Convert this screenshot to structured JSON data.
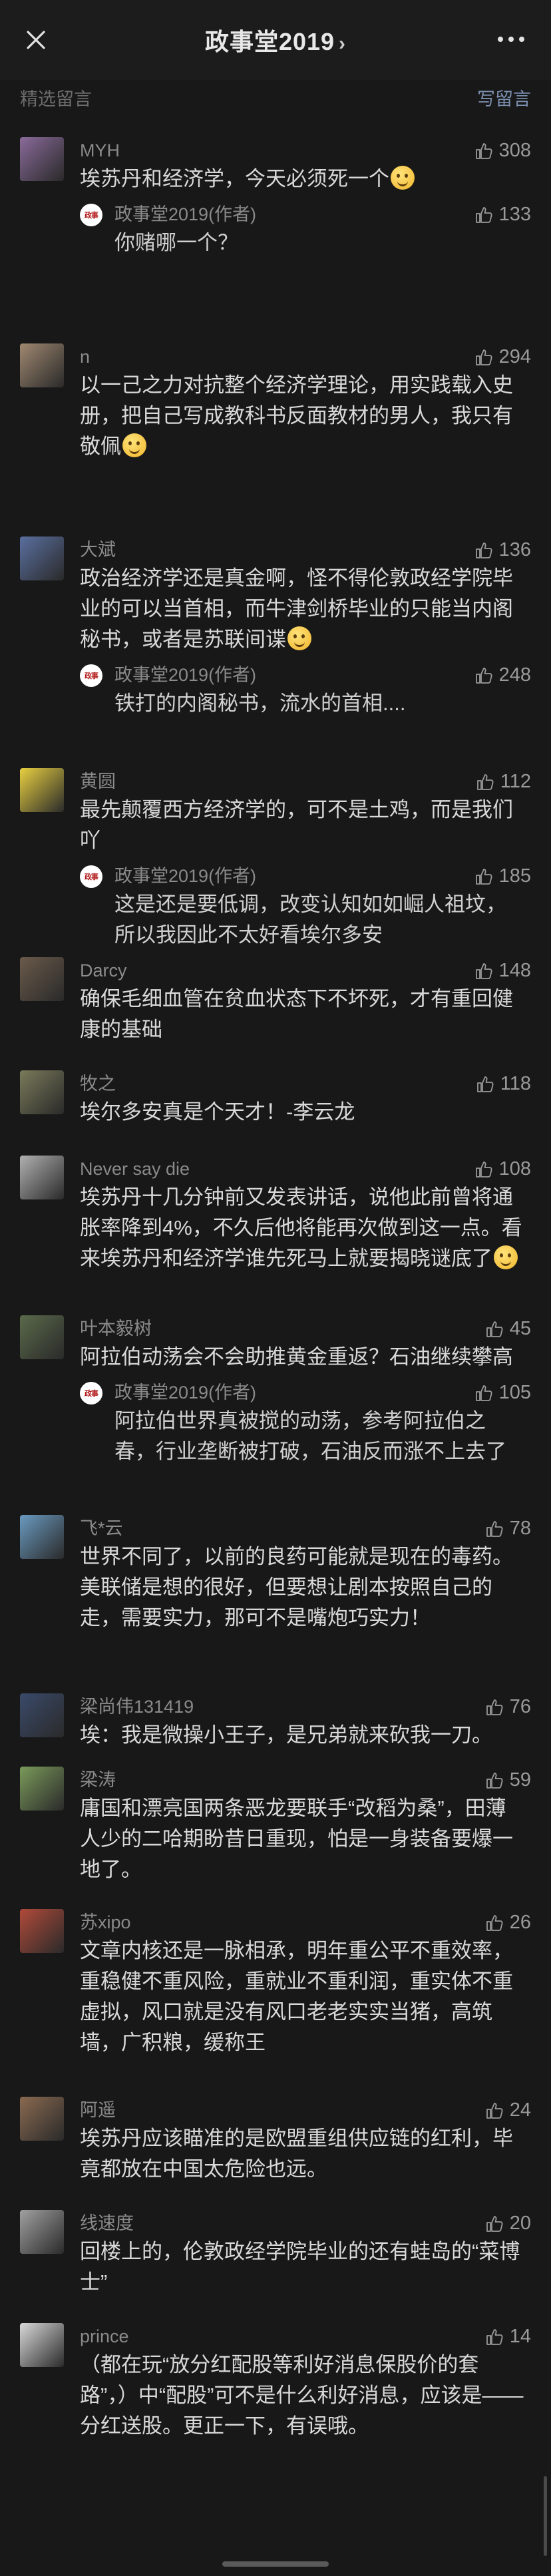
{
  "header": {
    "title": "政事堂2019",
    "chevron": "›",
    "close_icon": "close-icon",
    "more_icon": "more-icon"
  },
  "subbar": {
    "label": "精选留言",
    "write": "写留言"
  },
  "comments": [
    {
      "name": "MYH",
      "likes": "308",
      "text": "埃苏丹和经济学，今天必须死一个",
      "emoji": true,
      "avatar_color": "#8a6a9a",
      "reply": {
        "name": "政事堂2019(作者)",
        "likes": "133",
        "text": "你赌哪一个？"
      }
    },
    {
      "name": "n",
      "likes": "294",
      "text": "以一己之力对抗整个经济学理论，用实践载入史册，把自己写成教科书反面教材的男人，我只有敬佩",
      "emoji": true,
      "avatar_color": "#a08870"
    },
    {
      "name": "大斌",
      "likes": "136",
      "text": "政治经济学还是真金啊，怪不得伦敦政经学院毕业的可以当首相，而牛津剑桥毕业的只能当内阁秘书，或者是苏联间谍",
      "emoji": true,
      "avatar_color": "#5a6fa0",
      "reply": {
        "name": "政事堂2019(作者)",
        "likes": "248",
        "text": "铁打的内阁秘书，流水的首相...."
      }
    },
    {
      "name": "黄圆",
      "likes": "112",
      "text": "最先颠覆西方经济学的，可不是土鸡，而是我们吖",
      "emoji": false,
      "avatar_color": "#e8d040",
      "reply": {
        "name": "政事堂2019(作者)",
        "likes": "185",
        "text": "这是还是要低调，改变认知如如崛人祖坟，所以我因此不太好看埃尔多安"
      }
    },
    {
      "name": "Darcy",
      "likes": "148",
      "text": "确保毛细血管在贫血状态下不坏死，才有重回健康的基础",
      "emoji": false,
      "avatar_color": "#6a5a4a"
    },
    {
      "name": "牧之",
      "likes": "118",
      "text": "埃尔多安真是个天才！-李云龙",
      "emoji": false,
      "avatar_color": "#7a7a5a"
    },
    {
      "name": "Never say die",
      "likes": "108",
      "text": "埃苏丹十几分钟前又发表讲话，说他此前曾将通胀率降到4%，不久后他将能再次做到这一点。看来埃苏丹和经济学谁先死马上就要揭晓谜底了",
      "emoji": true,
      "avatar_color": "#b0b0b0"
    },
    {
      "name": "叶本毅树",
      "likes": "45",
      "text": "阿拉伯动荡会不会助推黄金重返？石油继续攀高",
      "emoji": false,
      "avatar_color": "#5a6a4a",
      "reply": {
        "name": "政事堂2019(作者)",
        "likes": "105",
        "text": "阿拉伯世界真被搅的动荡，参考阿拉伯之春，行业垄断被打破，石油反而涨不上去了"
      }
    },
    {
      "name": "飞*云",
      "likes": "78",
      "text": "世界不同了，以前的良药可能就是现在的毒药。美联储是想的很好，但要想让剧本按照自己的走，需要实力，那可不是嘴炮巧实力！",
      "emoji": false,
      "avatar_color": "#6a9ac0"
    },
    {
      "name": "梁尚伟131419",
      "likes": "76",
      "text": "埃：我是微操小王子，是兄弟就来砍我一刀。",
      "emoji": false,
      "avatar_color": "#3a4a6a"
    },
    {
      "name": "梁涛",
      "likes": "59",
      "text": "庸国和漂亮国两条恶龙要联手“改稻为桑”，田薄人少的二哈期盼昔日重现，怕是一身装备要爆一地了。",
      "emoji": false,
      "avatar_color": "#7a9a5a"
    },
    {
      "name": "苏xipo",
      "likes": "26",
      "text": "文章内核还是一脉相承，明年重公平不重效率，重稳健不重风险，重就业不重利润，重实体不重虚拟，风口就是没有风口老老实实当猪，高筑墙，广积粮，缓称王",
      "emoji": false,
      "avatar_color": "#b04a3a"
    },
    {
      "name": "阿遥",
      "likes": "24",
      "text": "埃苏丹应该瞄准的是欧盟重组供应链的红利，毕竟都放在中国太危险也远。",
      "emoji": false,
      "avatar_color": "#8a6a50"
    },
    {
      "name": "线速度",
      "likes": "20",
      "text": "回楼上的，伦敦政经学院毕业的还有蛙岛的“菜博士”",
      "emoji": false,
      "avatar_color": "#a0a0a0"
    },
    {
      "name": "prince",
      "likes": "14",
      "text": "（都在玩“放分红配股等利好消息保股价的套路”，）中“配股”可不是什么利好消息，应该是——分红送股。更正一下，有误哦。",
      "emoji": false,
      "avatar_color": "#d8d8d8"
    }
  ]
}
